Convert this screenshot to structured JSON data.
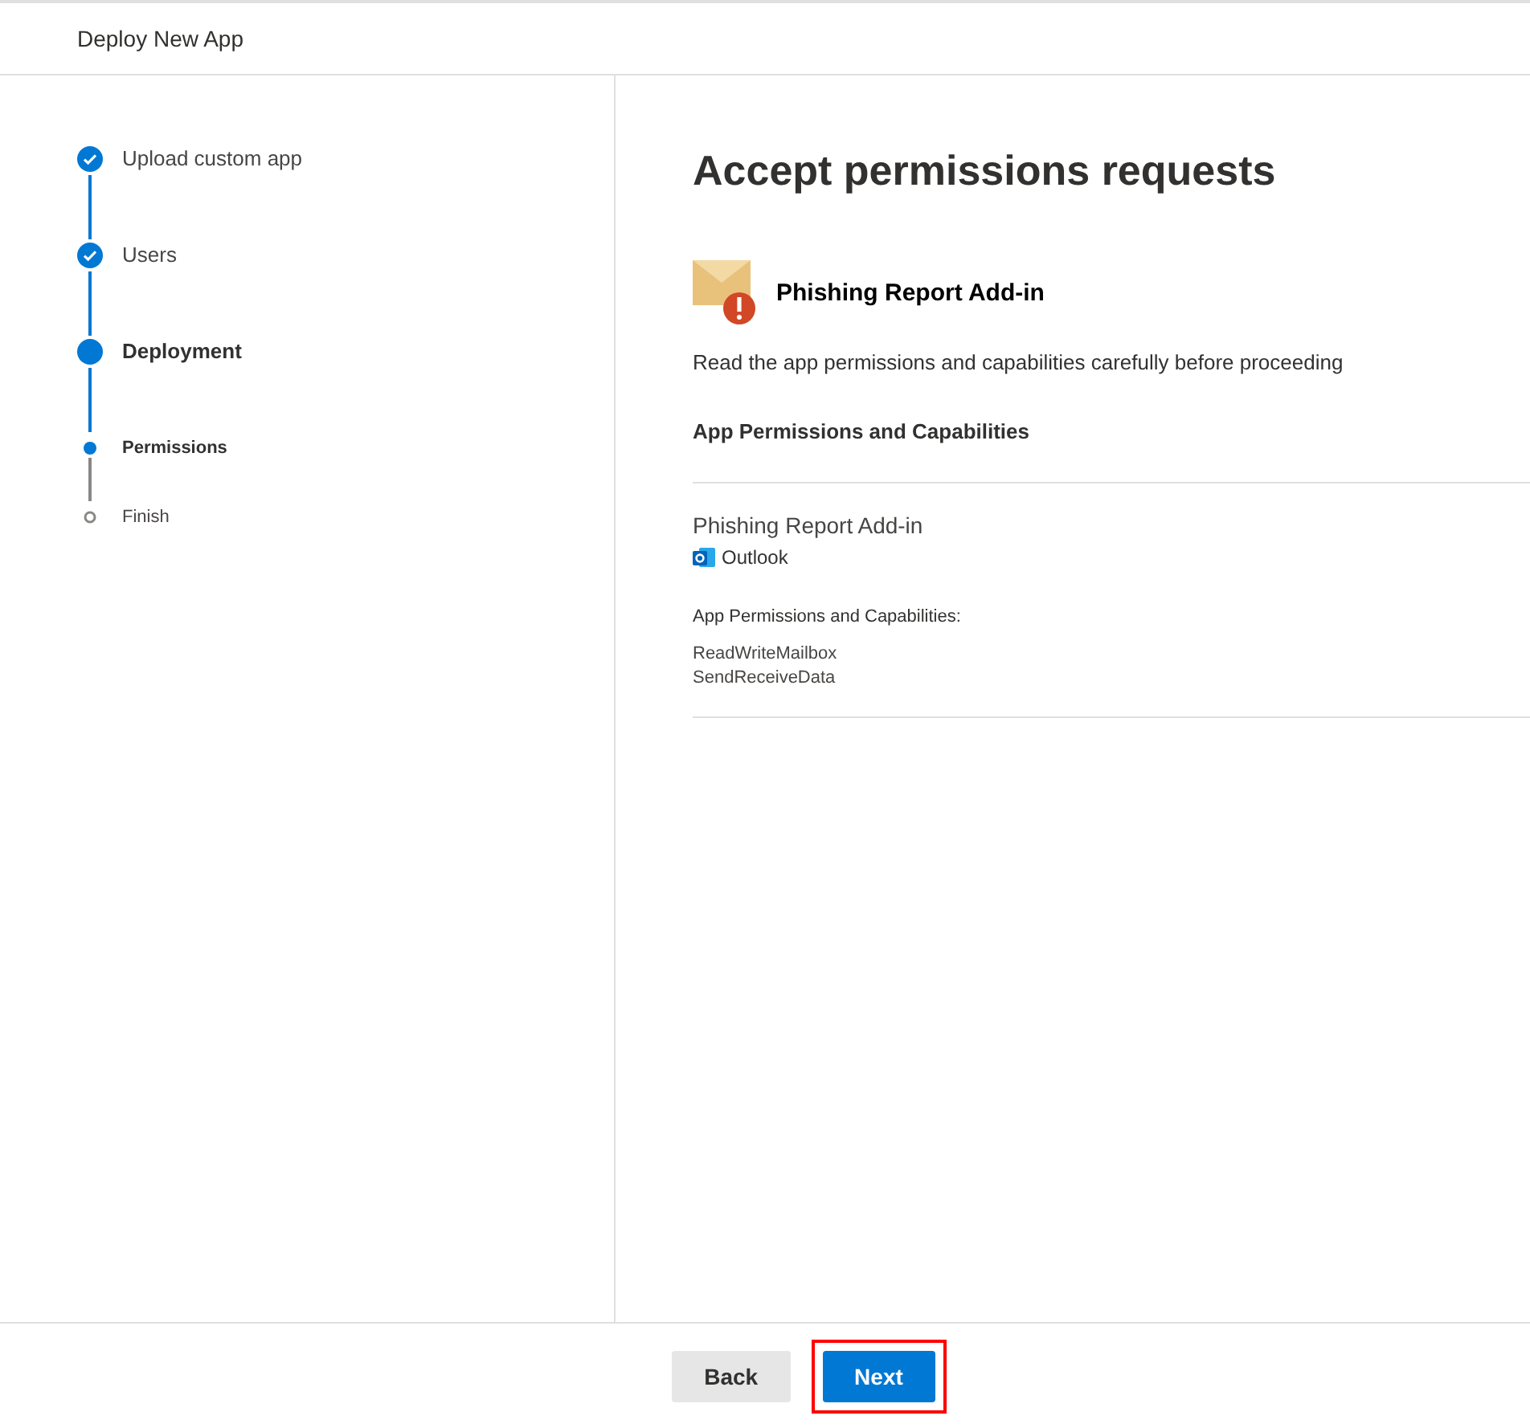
{
  "window": {
    "title": "Deploy New App"
  },
  "steps": [
    {
      "label": "Upload custom app",
      "kind": "step",
      "completed": true,
      "selected": false
    },
    {
      "label": "Users",
      "kind": "step",
      "completed": true,
      "selected": false
    },
    {
      "label": "Deployment",
      "kind": "step",
      "completed": false,
      "selected": true
    },
    {
      "label": "Permissions",
      "kind": "substep",
      "completed": false,
      "selected": true
    },
    {
      "label": "Finish",
      "kind": "substep",
      "completed": false,
      "selected": false
    }
  ],
  "main": {
    "heading": "Accept permissions requests",
    "app_name": "Phishing Report Add-in",
    "instructions": "Read the app permissions and capabilities carefully before proceeding",
    "section_title": "App Permissions and Capabilities",
    "detail": {
      "app_name": "Phishing Report Add-in",
      "host": "Outlook",
      "permissions_title": "App Permissions and Capabilities:",
      "permissions": [
        "ReadWriteMailbox",
        "SendReceiveData"
      ]
    }
  },
  "footer": {
    "buttons": [
      {
        "label": "Back",
        "kind": "secondary",
        "highlighted": false
      },
      {
        "label": "Next",
        "kind": "primary",
        "highlighted": true
      }
    ]
  }
}
